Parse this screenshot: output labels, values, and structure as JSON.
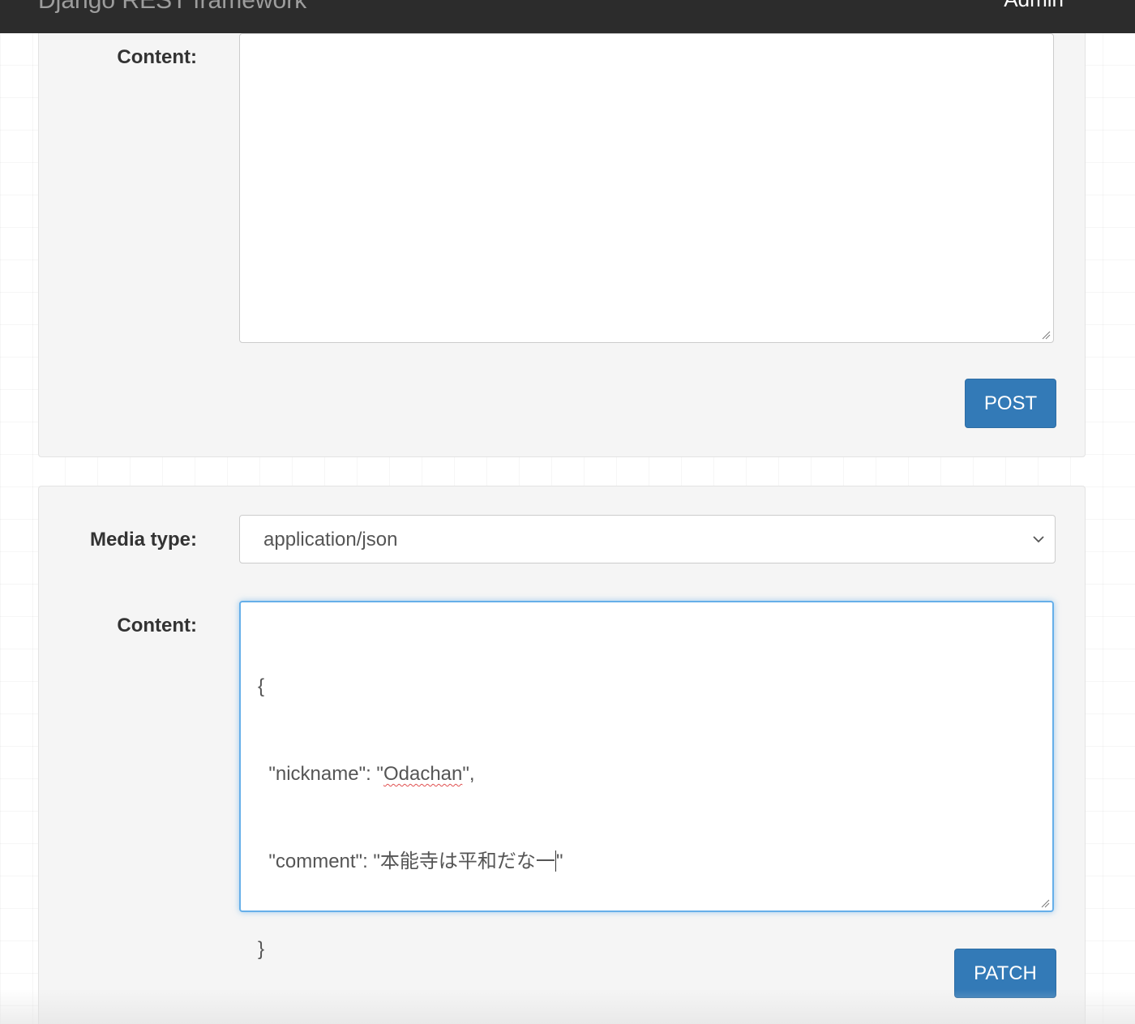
{
  "navbar": {
    "brand": "Django REST framework",
    "user": "Admin"
  },
  "post_form": {
    "content_label": "Content:",
    "content_value": "",
    "submit_label": "POST"
  },
  "patch_form": {
    "media_type_label": "Media type:",
    "media_type_value": "application/json",
    "content_label": "Content:",
    "content_lines": {
      "l1": "{",
      "l2_prefix": "  \"nickname\": \"",
      "l2_word": "Odachan",
      "l2_suffix": "\",",
      "l3_prefix": "  \"comment\": \"本能寺は平和だな一",
      "l3_suffix": "\"",
      "l4": "}"
    },
    "submit_label": "PATCH"
  },
  "colors": {
    "navbar_bg": "#2c2c2c",
    "well_bg": "#f5f5f5",
    "primary_button": "#337ab7",
    "focus_border": "#66afe9"
  },
  "icons": {
    "select_arrow": "chevron-down-icon",
    "resize_grip": "resize-grip-icon"
  }
}
